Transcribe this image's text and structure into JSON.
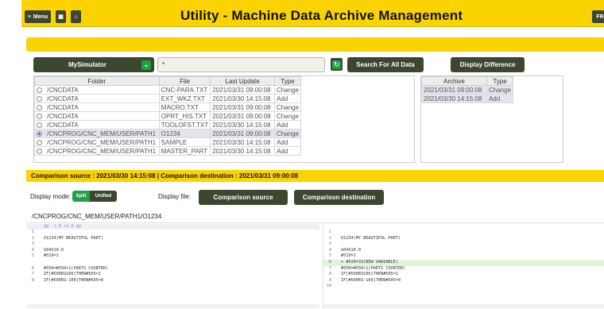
{
  "header": {
    "menu_label": "Menu",
    "title": "Utility - Machine Data Archive Management",
    "right_label": "FR"
  },
  "controls": {
    "machine_select": "MySimulator",
    "filter_value": "*",
    "search_all_label": "Search For All Data",
    "display_difference_label": "Display Difference"
  },
  "file_table": {
    "headers": [
      "Folder",
      "File",
      "Last Update",
      "Type"
    ],
    "rows": [
      {
        "folder": "/CNCDATA",
        "file": "CNC-PARA.TXT",
        "last_update": "2021/03/31 09:00:08",
        "type": "Change",
        "selected": false
      },
      {
        "folder": "/CNCDATA",
        "file": "EXT_WKZ.TXT",
        "last_update": "2021/03/30 14:15:08",
        "type": "Add",
        "selected": false
      },
      {
        "folder": "/CNCDATA",
        "file": "MACRO.TXT",
        "last_update": "2021/03/31 09:00:08",
        "type": "Change",
        "selected": false
      },
      {
        "folder": "/CNCDATA",
        "file": "OPRT_HIS.TXT",
        "last_update": "2021/03/31 09:00:08",
        "type": "Change",
        "selected": false
      },
      {
        "folder": "/CNCDATA",
        "file": "TOOLOFST.TXT",
        "last_update": "2021/03/30 14:15:08",
        "type": "Add",
        "selected": false
      },
      {
        "folder": "/CNCPROG/CNC_MEM/USER/PATH1",
        "file": "O1234",
        "last_update": "2021/03/31 09:00:08",
        "type": "Change",
        "selected": true
      },
      {
        "folder": "/CNCPROG/CNC_MEM/USER/PATH1",
        "file": "SAMPLE",
        "last_update": "2021/03/30 14:15:08",
        "type": "Add",
        "selected": false
      },
      {
        "folder": "/CNCPROG/CNC_MEM/USER/PATH1",
        "file": "MASTER_PART",
        "last_update": "2021/03/30 14:15:08",
        "type": "Add",
        "selected": false
      }
    ]
  },
  "archive_table": {
    "headers": [
      "Archive",
      "Type"
    ],
    "rows": [
      {
        "archive": "2021/03/31 09:00:08",
        "type": "Change"
      },
      {
        "archive": "2021/03/30 14:15:08",
        "type": "Add"
      }
    ]
  },
  "comparison": {
    "bar_text": "Comparison source : 2021/03/30 14:15:08 | Comparison destination : 2021/03/31 09:00:08",
    "display_mode_label": "Display mode:",
    "mode_split": "Split",
    "mode_unified": "Unified",
    "display_file_label": "Display file:",
    "source_button": "Comparison source",
    "destination_button": "Comparison destination",
    "path": "/CNCPROG/CNC_MEM/USER/PATH1/O1234"
  },
  "diff": {
    "hunk": "@@ -1,8 +1,9 @@",
    "left": [
      {
        "n": "1",
        "text": ""
      },
      {
        "n": "2",
        "text": "O1234(MY BEAUTIFUL PART)"
      },
      {
        "n": "3",
        "text": ""
      },
      {
        "n": "4",
        "text": "G04X10.0"
      },
      {
        "n": "5",
        "text": "#510=1"
      },
      {
        "n": "",
        "text": ""
      },
      {
        "n": "6",
        "text": "#550=#550+1(PARTS COUNTER)"
      },
      {
        "n": "7",
        "text": "IF[#500EQ100]THEN#505=1"
      },
      {
        "n": "8",
        "text": "IF[#500EQ-100]THEN#505=0"
      }
    ],
    "right": [
      {
        "n": "1",
        "text": "",
        "add": false
      },
      {
        "n": "2",
        "text": "O1234(MY BEAUTIFUL PART)",
        "add": false
      },
      {
        "n": "3",
        "text": "",
        "add": false
      },
      {
        "n": "4",
        "text": "G04X10.0",
        "add": false
      },
      {
        "n": "5",
        "text": "#510=1",
        "add": false
      },
      {
        "n": "6",
        "text": "+ #520=33(NEW VARIABLE)",
        "add": true
      },
      {
        "n": "7",
        "text": "#550=#550+1(PARTS COUNTER)",
        "add": false
      },
      {
        "n": "8",
        "text": "IF[#500EQ100]THEN#505=1",
        "add": false
      },
      {
        "n": "9",
        "text": "IF[#500EQ-100]THEN#505=0",
        "add": false
      },
      {
        "n": "10",
        "text": "",
        "add": false
      }
    ]
  }
}
